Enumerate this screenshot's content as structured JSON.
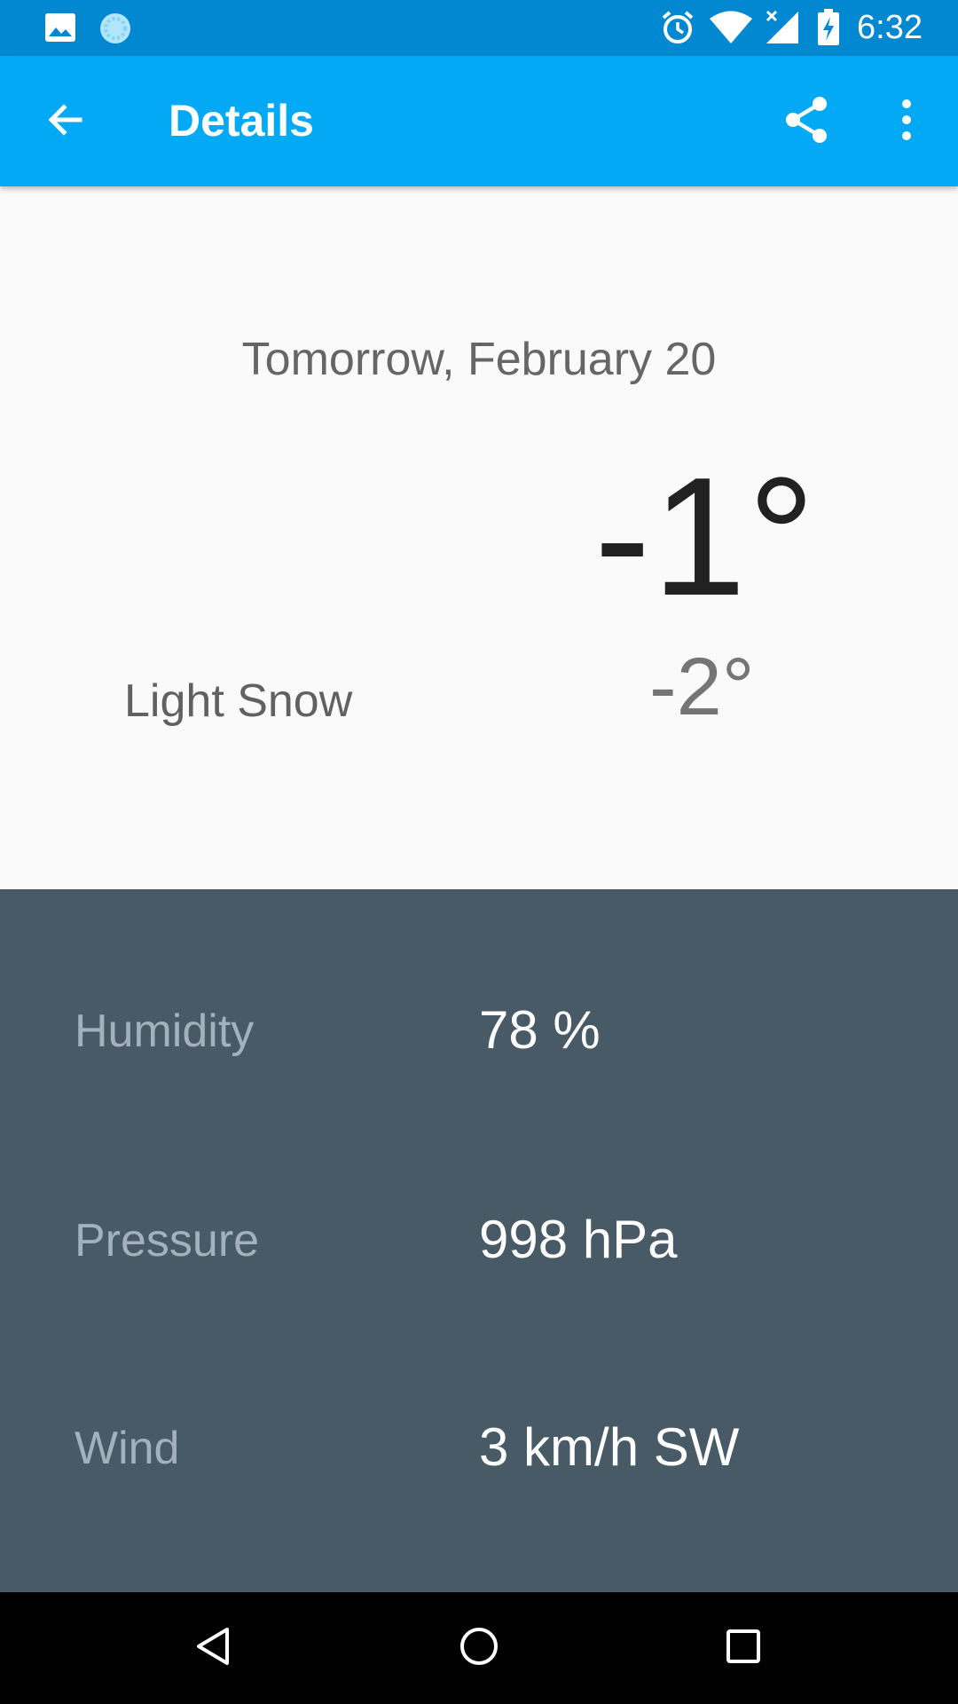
{
  "status_bar": {
    "time": "6:32",
    "icons": [
      "image-icon",
      "sync-icon",
      "alarm-icon",
      "wifi-icon",
      "signal-icon",
      "battery-charging-icon"
    ]
  },
  "app_bar": {
    "title": "Details",
    "background": "#03a9f4",
    "actions": [
      "back-arrow-icon",
      "share-icon",
      "more-vert-icon"
    ]
  },
  "forecast": {
    "date": "Tomorrow, February 20",
    "high": "-1°",
    "low": "-2°",
    "condition": "Light Snow"
  },
  "details": {
    "background": "#485a66",
    "rows": [
      {
        "label": "Humidity",
        "value": "78 %"
      },
      {
        "label": "Pressure",
        "value": "998 hPa"
      },
      {
        "label": "Wind",
        "value": "3 km/h SW"
      }
    ]
  },
  "nav_bar": {
    "buttons": [
      "back-triangle-icon",
      "home-circle-icon",
      "recents-square-icon"
    ]
  }
}
